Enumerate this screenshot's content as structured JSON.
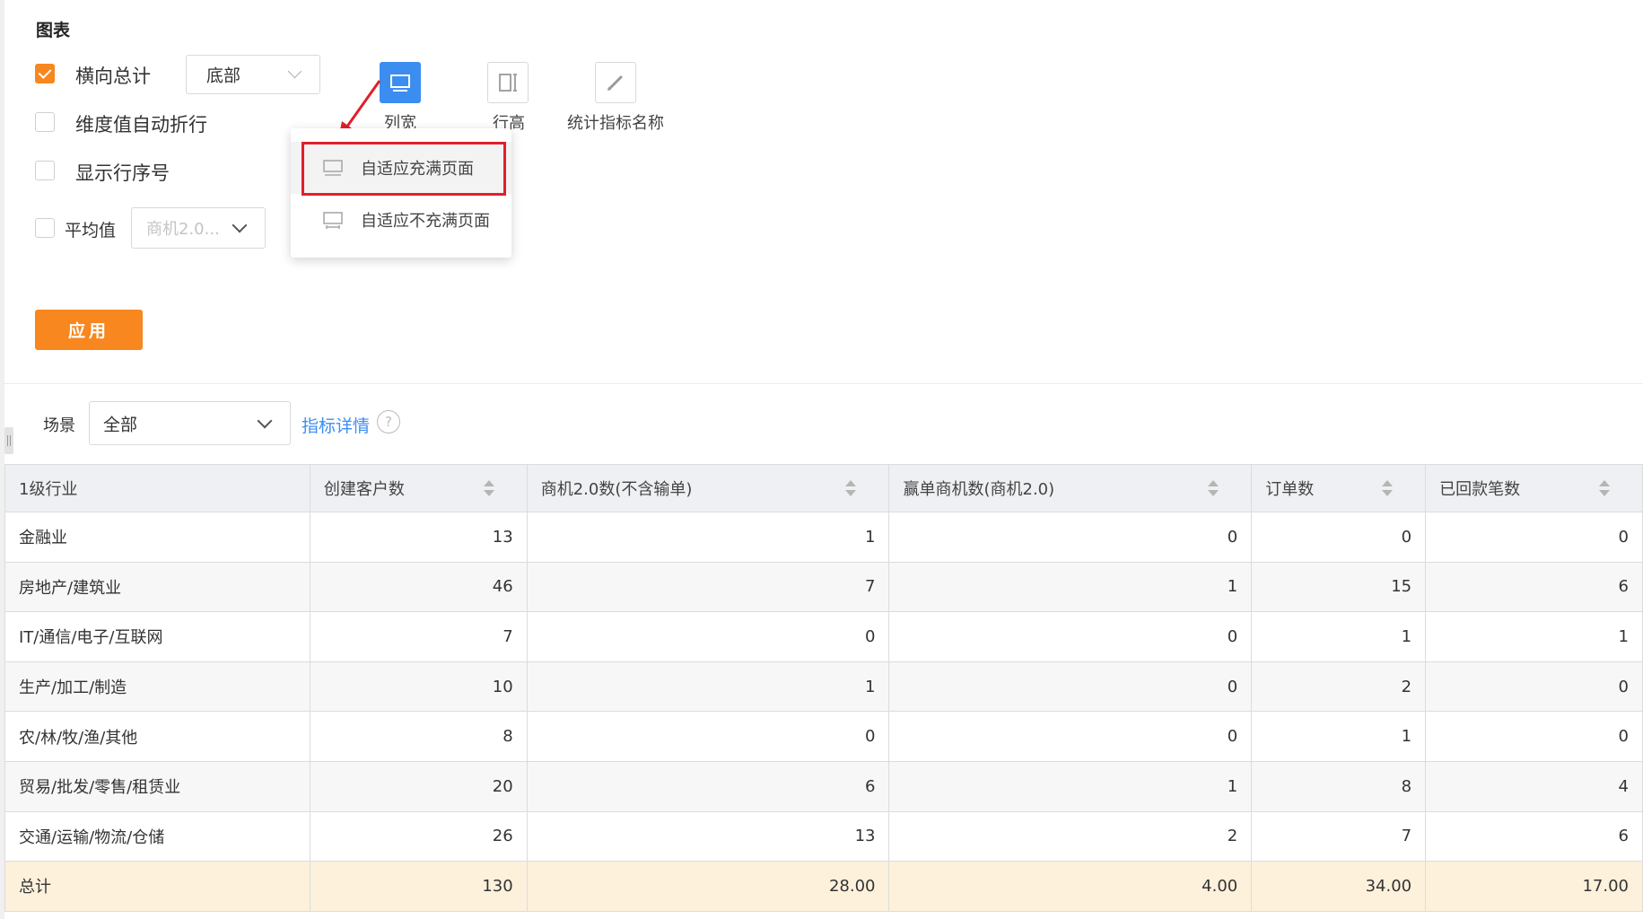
{
  "section_title": "图表",
  "options": {
    "horizontal_total": {
      "label": "横向总计",
      "checked": true,
      "position_select": "底部"
    },
    "auto_wrap": {
      "label": "维度值自动折行",
      "checked": false
    },
    "row_number": {
      "label": "显示行序号",
      "checked": false
    },
    "average": {
      "label": "平均值",
      "checked": false,
      "metric_select": "商机2.0..."
    }
  },
  "toolbar": {
    "col_width": "列宽",
    "row_height": "行高",
    "metric_name": "统计指标名称"
  },
  "col_width_menu": {
    "items": [
      "自适应充满页面",
      "自适应不充满页面"
    ]
  },
  "apply_label": "应用",
  "filter": {
    "scene_label": "场景",
    "scene_value": "全部",
    "detail_link": "指标详情",
    "help": "?"
  },
  "table": {
    "headers": [
      "1级行业",
      "创建客户数",
      "商机2.0数(不含输单)",
      "赢单商机数(商机2.0)",
      "订单数",
      "已回款笔数"
    ],
    "rows": [
      [
        "金融业",
        "13",
        "1",
        "0",
        "0",
        "0"
      ],
      [
        "房地产/建筑业",
        "46",
        "7",
        "1",
        "15",
        "6"
      ],
      [
        "IT/通信/电子/互联网",
        "7",
        "0",
        "0",
        "1",
        "1"
      ],
      [
        "生产/加工/制造",
        "10",
        "1",
        "0",
        "2",
        "0"
      ],
      [
        "农/林/牧/渔/其他",
        "8",
        "0",
        "0",
        "1",
        "0"
      ],
      [
        "贸易/批发/零售/租赁业",
        "20",
        "6",
        "1",
        "8",
        "4"
      ],
      [
        "交通/运输/物流/仓储",
        "26",
        "13",
        "2",
        "7",
        "6"
      ]
    ],
    "total": [
      "总计",
      "130",
      "28.00",
      "4.00",
      "34.00",
      "17.00"
    ]
  },
  "colors": {
    "accent": "#f7871e",
    "primary": "#3c8df0",
    "highlight": "#e0202a",
    "total_row": "#fdf1dc"
  }
}
